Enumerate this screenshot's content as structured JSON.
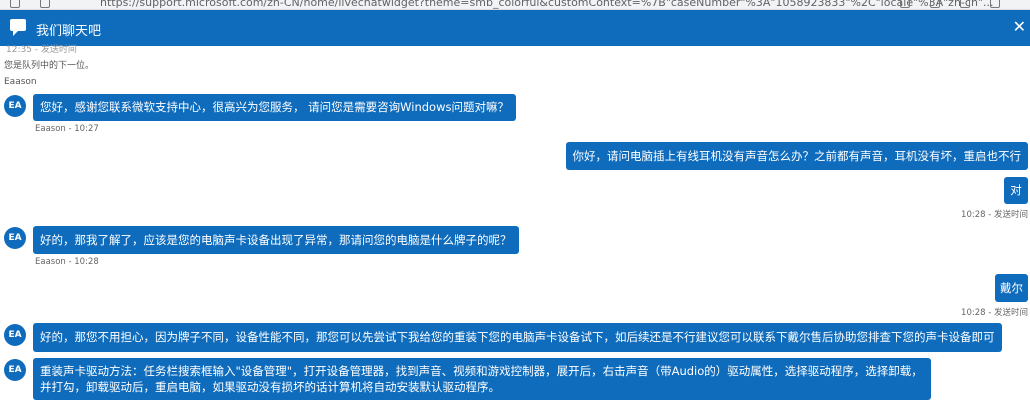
{
  "browser": {
    "url": "https://support.microsoft.com/zh-CN/home/livechatwidget?theme=smb_colorful&customContext=%7B\"caseNumber\"%3A\"1058923833\"%2C\"locale\"%3A\"zh-cn\"..."
  },
  "chat": {
    "title": "我们聊天吧",
    "cut_text": "12:35 - 发送时间",
    "queue_text": "您是队列中的下一位。",
    "agent_name": "Eaason"
  },
  "messages": [
    {
      "from": "agent",
      "avatar": "EA",
      "text": "您好，感谢您联系微软支持中心，很高兴为您服务， 请问您是需要咨询Windows问题对嘛？",
      "meta": "Eaason - 10:27"
    },
    {
      "from": "user",
      "text": "你好，请问电脑插上有线耳机没有声音怎么办？之前都有声音，耳机没有坏，重启也不行",
      "meta": ""
    },
    {
      "from": "user",
      "text": "对",
      "meta": "10:28 - 发送时间"
    },
    {
      "from": "agent",
      "avatar": "EA",
      "text": "好的，那我了解了，应该是您的电脑声卡设备出现了异常，那请问您的电脑是什么牌子的呢？",
      "meta": "Eaason - 10:28"
    },
    {
      "from": "user",
      "text": "戴尔",
      "meta": "10:28 - 发送时间"
    },
    {
      "from": "agent",
      "avatar": "EA",
      "text": "好的，那您不用担心，因为牌子不同，设备性能不同，那您可以先尝试下我给您的重装下您的电脑声卡设备试下，如后续还是不行建议您可以联系下戴尔售后协助您排查下您的声卡设备即可",
      "meta": ""
    },
    {
      "from": "agent",
      "avatar": "EA",
      "text": "重装声卡驱动方法：任务栏搜索框输入\"设备管理\"，打开设备管理器，找到声音、视频和游戏控制器，展开后，右击声音（带Audio的）驱动属性，选择驱动程序，选择卸载，并打勾，卸载驱动后，重启电脑，如果驱动没有损坏的话计算机将自动安装默认驱动程序。",
      "meta": ""
    }
  ]
}
